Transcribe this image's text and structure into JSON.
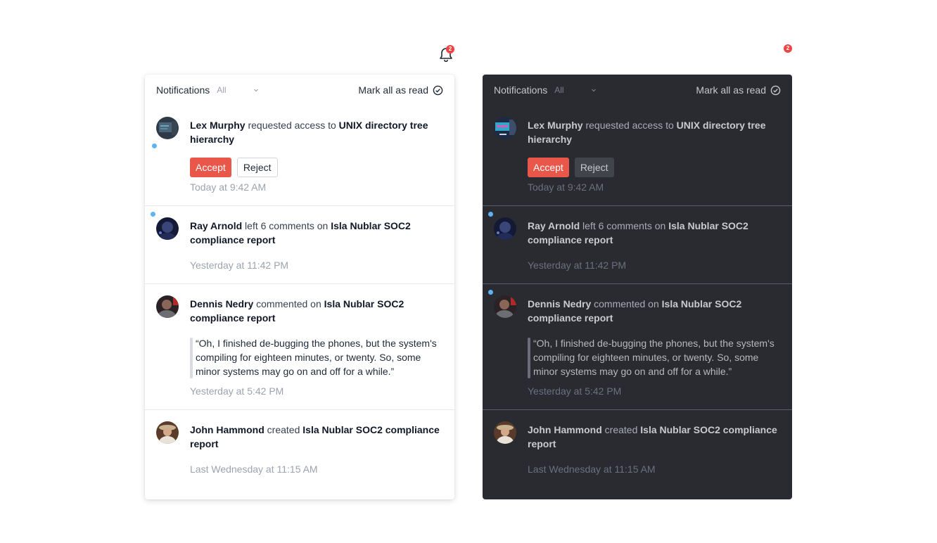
{
  "bell": {
    "icon": "bell-icon",
    "unread_count": "2"
  },
  "dark_badge": {
    "unread_count": "2"
  },
  "panels": [
    {
      "theme": "light",
      "header": {
        "title": "Notifications",
        "filter_value": "All",
        "mark_all_label": "Mark all as read"
      },
      "items": [
        {
          "actor": "Lex Murphy",
          "action": " requested access to ",
          "target": "UNIX directory tree hierarchy",
          "accept_label": "Accept",
          "reject_label": "Reject",
          "time": "Today at 9:42 AM",
          "unread": true
        },
        {
          "actor": "Ray Arnold",
          "action": " left 6 comments on ",
          "target": "Isla Nublar SOC2 compliance report",
          "time": "Yesterday at 11:42 PM",
          "unread": true
        },
        {
          "actor": "Dennis Nedry",
          "action": " commented on ",
          "target": "Isla Nublar SOC2 compliance report",
          "quote": "“Oh, I finished de-bugging the phones, but the system's compiling for eighteen minutes, or twenty. So, some minor systems may go on and off for a while.”",
          "time": "Yesterday at 5:42 PM",
          "unread": false
        },
        {
          "actor": "John Hammond",
          "action": " created ",
          "target": "Isla Nublar SOC2 compliance report",
          "time": "Last Wednesday at 11:15 AM",
          "unread": false
        }
      ]
    },
    {
      "theme": "dark",
      "header": {
        "title": "Notifications",
        "filter_value": "All",
        "mark_all_label": "Mark all as read"
      },
      "items": [
        {
          "actor": "Lex Murphy",
          "action": " requested access to ",
          "target": "UNIX directory tree hierarchy",
          "accept_label": "Accept",
          "reject_label": "Reject",
          "time": "Today at 9:42 AM",
          "unread": false
        },
        {
          "actor": "Ray Arnold",
          "action": " left 6 comments on ",
          "target": "Isla Nublar SOC2 compliance report",
          "time": "Yesterday at 11:42 PM",
          "unread": true
        },
        {
          "actor": "Dennis Nedry",
          "action": " commented on ",
          "target": "Isla Nublar SOC2 compliance report",
          "quote": "“Oh, I finished de-bugging the phones, but the system's compiling for eighteen minutes, or twenty. So, some minor systems may go on and off for a while.”",
          "time": "Yesterday at 5:42 PM",
          "unread": true
        },
        {
          "actor": "John Hammond",
          "action": " created ",
          "target": "Isla Nublar SOC2 compliance report",
          "time": "Last Wednesday at 11:15 AM",
          "unread": false
        }
      ]
    }
  ],
  "colors": {
    "accent": "#e9574a",
    "unread_dot": "#5cb4f5",
    "badge": "#ef4444",
    "dark_bg": "#2a2b30"
  }
}
